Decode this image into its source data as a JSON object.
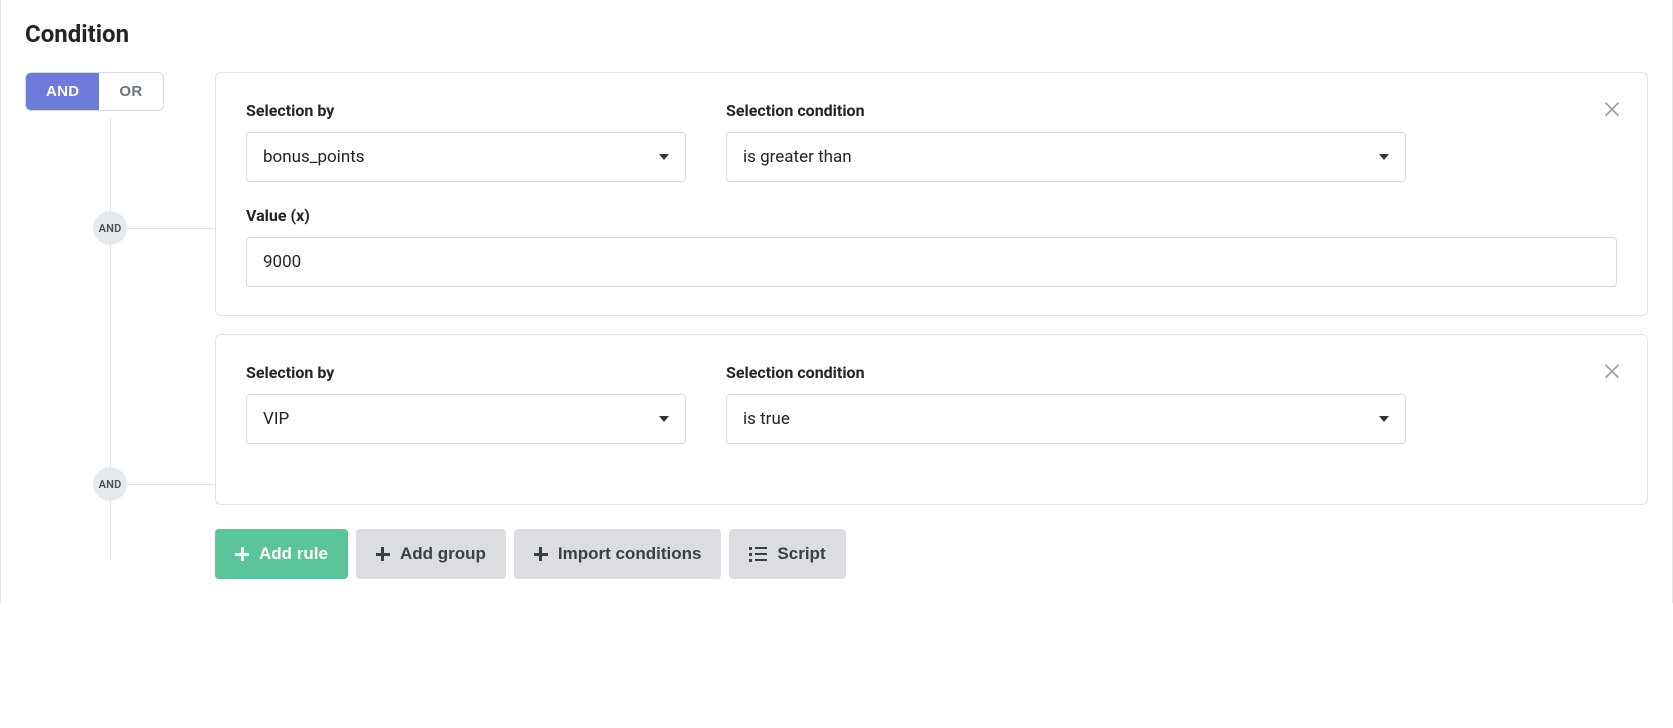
{
  "section": {
    "title": "Condition"
  },
  "logic_toggle": {
    "and_label": "AND",
    "or_label": "OR",
    "active": "and"
  },
  "tree": {
    "node_label": "AND"
  },
  "labels": {
    "selection_by": "Selection by",
    "selection_condition": "Selection condition",
    "value_x": "Value (x)"
  },
  "rules": [
    {
      "selection_by": "bonus_points",
      "selection_condition": "is greater than",
      "has_value": true,
      "value": "9000"
    },
    {
      "selection_by": "VIP",
      "selection_condition": "is true",
      "has_value": false,
      "value": ""
    }
  ],
  "actions": {
    "add_rule": "Add rule",
    "add_group": "Add group",
    "import_conditions": "Import conditions",
    "script": "Script"
  }
}
